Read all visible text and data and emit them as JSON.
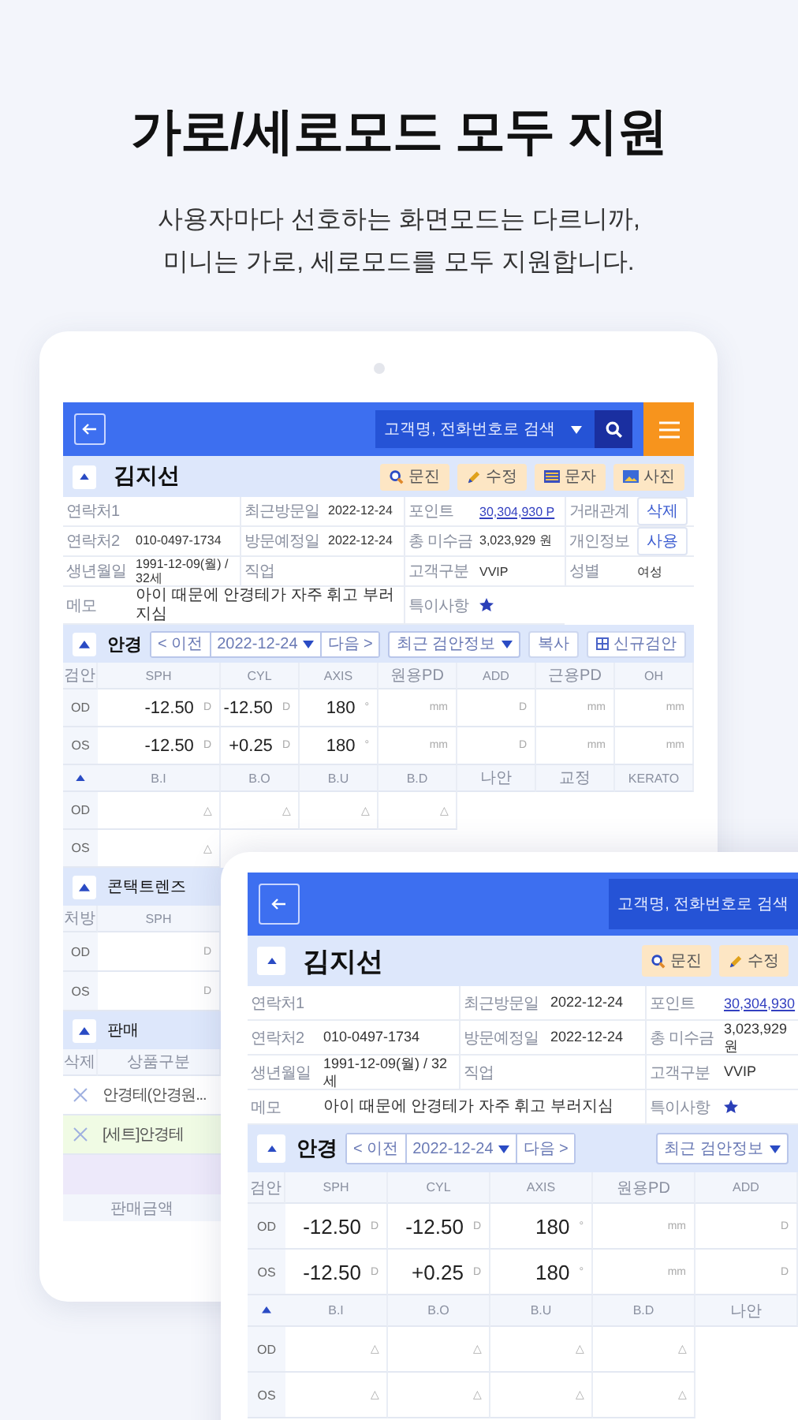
{
  "headline": "가로/세로모드 모두 지원",
  "subtitle": "사용자마다 선호하는 화면모드는 다르니까,\n미니는 가로, 세로모드를 모두 지원합니다.",
  "back_tablet": {
    "header": {
      "search": {
        "placeholder": "고객명, 전화번호로 검색",
        "dropdown": true,
        "button": true
      },
      "menu_button": true
    },
    "customer": {
      "name": "김지선",
      "buttons": [
        {
          "label": "문진"
        },
        {
          "label": "수정"
        },
        {
          "label": "문자"
        },
        {
          "label": "사진"
        }
      ]
    },
    "info_rows": [
      [
        {
          "label": "연락처1"
        },
        {
          "label": "최근방문일",
          "value": "2022-12-24",
          "kind": "text"
        },
        {
          "label": "포인트",
          "value": "30,304,930 P",
          "kind": "link"
        },
        {
          "label": "거래관계",
          "value": "삭제",
          "kind": "button"
        }
      ],
      [
        {
          "label": "연락처2",
          "value": "010-0497-1734",
          "kind": "text"
        },
        {
          "label": "방문예정일",
          "value": "2022-12-24",
          "kind": "text"
        },
        {
          "label": "총 미수금",
          "value": "3,023,929 원",
          "kind": "text"
        },
        {
          "label": "개인정보",
          "value": "사용",
          "kind": "button"
        }
      ],
      [
        {
          "label": "생년월일",
          "value": "1991-12-09(월) / 32세",
          "kind": "text"
        },
        {
          "label": "직업"
        },
        {
          "label": "고객구분",
          "value": "VVIP",
          "kind": "text"
        },
        {
          "label": "성별",
          "value": "여성",
          "kind": "text"
        }
      ],
      [
        {
          "label": "메모",
          "value": "아이 때문에 안경테가 자주 휘고 부러지심",
          "kind": "memo"
        },
        {
          "label": "특이사항",
          "kind": "star"
        }
      ]
    ],
    "glasses": {
      "title": "안경",
      "prev": "< 이전",
      "date": "2022-12-24",
      "next": "다음 >",
      "recent": "최근 검안정보",
      "copy": "복사",
      "new": "신규검안",
      "tables": [
        {
          "header": [
            "검안",
            "SPH",
            "CYL",
            "AXIS",
            "원용PD",
            "ADD",
            "근용PD",
            "OH"
          ],
          "rows": [
            {
              "eye": "OD",
              "cells": [
                {
                  "value": "-12.50",
                  "unit": "D"
                },
                {
                  "value": "-12.50",
                  "unit": "D"
                },
                {
                  "value": "180",
                  "unit": "°"
                },
                {
                  "unit": "mm"
                },
                {
                  "unit": "D"
                },
                {
                  "unit": "mm"
                },
                {
                  "unit": "mm"
                }
              ]
            },
            {
              "eye": "OS",
              "cells": [
                {
                  "value": "-12.50",
                  "unit": "D"
                },
                {
                  "value": "+0.25",
                  "unit": "D"
                },
                {
                  "value": "180",
                  "unit": "°"
                },
                {
                  "unit": "mm"
                },
                {
                  "unit": "D"
                },
                {
                  "unit": "mm"
                },
                {
                  "unit": "mm"
                }
              ]
            }
          ]
        },
        {
          "header": [
            "B.I",
            "B.O",
            "B.U",
            "B.D",
            "나안",
            "교정",
            "KERATO"
          ],
          "rows": [
            {
              "eye": "OD",
              "cells": [
                {
                  "unit": "△"
                },
                {
                  "unit": "△"
                },
                {
                  "unit": "△"
                },
                {
                  "unit": "△"
                }
              ]
            },
            {
              "eye": "OS",
              "cells": [
                {
                  "unit": "△"
                }
              ]
            }
          ]
        }
      ]
    },
    "contacts": {
      "title": "콘택트렌즈",
      "header": [
        "처방",
        "SPH"
      ],
      "rows": [
        {
          "eye": "OD",
          "cells": [
            {
              "unit": "D"
            }
          ]
        },
        {
          "eye": "OS",
          "cells": [
            {
              "unit": "D"
            }
          ]
        }
      ]
    },
    "sales": {
      "title": "판매",
      "header": [
        "삭제",
        "상품구분"
      ],
      "rows": [
        {
          "product": "안경테(안경원...",
          "selected": false
        },
        {
          "product": "[세트]안경테",
          "selected": true
        }
      ],
      "footer": "판매금액"
    }
  },
  "front_tablet": {
    "header": {
      "search": {
        "placeholder": "고객명, 전화번호로 검색",
        "dropdown": false,
        "button": false
      },
      "menu_button": false
    },
    "customer": {
      "name": "김지선",
      "buttons": [
        {
          "label": "문진"
        },
        {
          "label": "수정"
        }
      ]
    },
    "info_rows": [
      [
        {
          "label": "연락처1"
        },
        {
          "label": "최근방문일",
          "value": "2022-12-24",
          "kind": "text"
        },
        {
          "label": "포인트",
          "value": "30,304,930",
          "kind": "link"
        }
      ],
      [
        {
          "label": "연락처2",
          "value": "010-0497-1734",
          "kind": "text"
        },
        {
          "label": "방문예정일",
          "value": "2022-12-24",
          "kind": "text"
        },
        {
          "label": "총 미수금",
          "value": "3,023,929 원",
          "kind": "text"
        }
      ],
      [
        {
          "label": "생년월일",
          "value": "1991-12-09(월) / 32세",
          "kind": "text"
        },
        {
          "label": "직업"
        },
        {
          "label": "고객구분",
          "value": "VVIP",
          "kind": "text"
        }
      ],
      [
        {
          "label": "메모",
          "value": "아이 때문에 안경테가 자주 휘고 부러지심",
          "kind": "memo"
        },
        {
          "label": "특이사항",
          "kind": "star"
        }
      ]
    ],
    "glasses": {
      "title": "안경",
      "prev": "< 이전",
      "date": "2022-12-24",
      "next": "다음 >",
      "recent": "최근 검안정보",
      "tables": [
        {
          "header": [
            "검안",
            "SPH",
            "CYL",
            "AXIS",
            "원용PD",
            "ADD"
          ],
          "rows": [
            {
              "eye": "OD",
              "cells": [
                {
                  "value": "-12.50",
                  "unit": "D"
                },
                {
                  "value": "-12.50",
                  "unit": "D"
                },
                {
                  "value": "180",
                  "unit": "°"
                },
                {
                  "unit": "mm"
                },
                {
                  "unit": "D"
                }
              ]
            },
            {
              "eye": "OS",
              "cells": [
                {
                  "value": "-12.50",
                  "unit": "D"
                },
                {
                  "value": "+0.25",
                  "unit": "D"
                },
                {
                  "value": "180",
                  "unit": "°"
                },
                {
                  "unit": "mm"
                },
                {
                  "unit": "D"
                }
              ]
            }
          ]
        },
        {
          "header": [
            "B.I",
            "B.O",
            "B.U",
            "B.D",
            "나안"
          ],
          "rows": [
            {
              "eye": "OD",
              "cells": [
                {
                  "unit": "△"
                },
                {
                  "unit": "△"
                },
                {
                  "unit": "△"
                },
                {
                  "unit": "△"
                }
              ]
            },
            {
              "eye": "OS",
              "cells": [
                {
                  "unit": "△"
                },
                {
                  "unit": "△"
                },
                {
                  "unit": "△"
                },
                {
                  "unit": "△"
                }
              ]
            }
          ]
        }
      ]
    }
  }
}
